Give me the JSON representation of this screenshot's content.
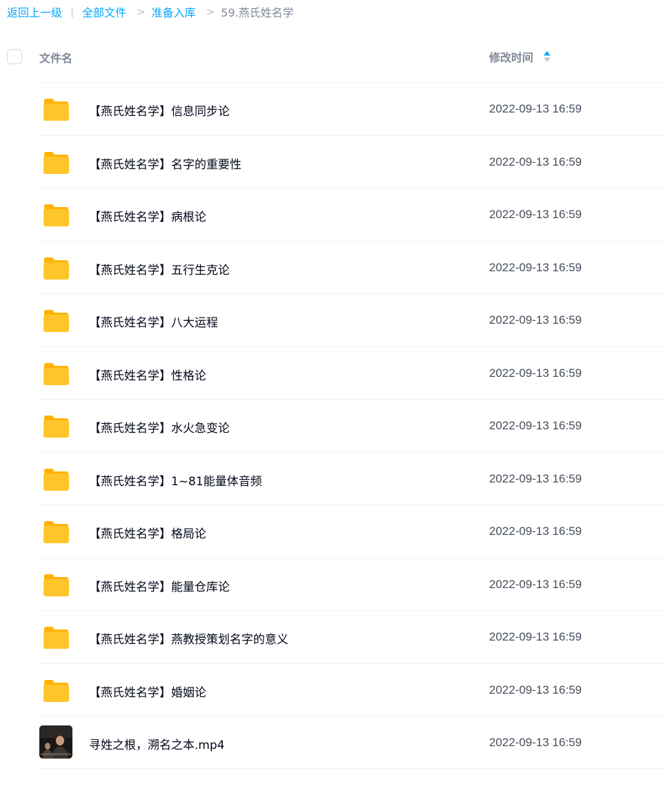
{
  "breadcrumb": {
    "back": "返回上一级",
    "separator": "|",
    "arrow": ">",
    "items": [
      "全部文件",
      "准备入库"
    ],
    "current": "59.燕氏姓名学"
  },
  "header": {
    "name_label": "文件名",
    "time_label": "修改时间",
    "sort_icon": "sort-icon"
  },
  "files": [
    {
      "name": "【燕氏姓名学】信息同步论",
      "time": "2022-09-13 16:59",
      "icon": "folder-icon"
    },
    {
      "name": "【燕氏姓名学】名字的重要性",
      "time": "2022-09-13 16:59",
      "icon": "folder-icon"
    },
    {
      "name": "【燕氏姓名学】病根论",
      "time": "2022-09-13 16:59",
      "icon": "folder-icon"
    },
    {
      "name": "【燕氏姓名学】五行生克论",
      "time": "2022-09-13 16:59",
      "icon": "folder-icon"
    },
    {
      "name": "【燕氏姓名学】八大运程",
      "time": "2022-09-13 16:59",
      "icon": "folder-icon"
    },
    {
      "name": "【燕氏姓名学】性格论",
      "time": "2022-09-13 16:59",
      "icon": "folder-icon"
    },
    {
      "name": "【燕氏姓名学】水火急变论",
      "time": "2022-09-13 16:59",
      "icon": "folder-icon"
    },
    {
      "name": "【燕氏姓名学】1~81能量体音频",
      "time": "2022-09-13 16:59",
      "icon": "folder-icon"
    },
    {
      "name": "【燕氏姓名学】格局论",
      "time": "2022-09-13 16:59",
      "icon": "folder-icon"
    },
    {
      "name": "【燕氏姓名学】能量仓库论",
      "time": "2022-09-13 16:59",
      "icon": "folder-icon"
    },
    {
      "name": "【燕氏姓名学】燕教授策划名字的意义",
      "time": "2022-09-13 16:59",
      "icon": "folder-icon"
    },
    {
      "name": "【燕氏姓名学】婚姻论",
      "time": "2022-09-13 16:59",
      "icon": "folder-icon"
    },
    {
      "name": "寻姓之根，溯名之本.mp4",
      "time": "2022-09-13 16:59",
      "icon": "video-thumbnail"
    }
  ],
  "colors": {
    "link": "#06a7ff",
    "folder": "#ffc62b",
    "folder_tab": "#ffb200",
    "sort_active": "#06a7ff",
    "sort_inactive": "#c4c8cf"
  }
}
